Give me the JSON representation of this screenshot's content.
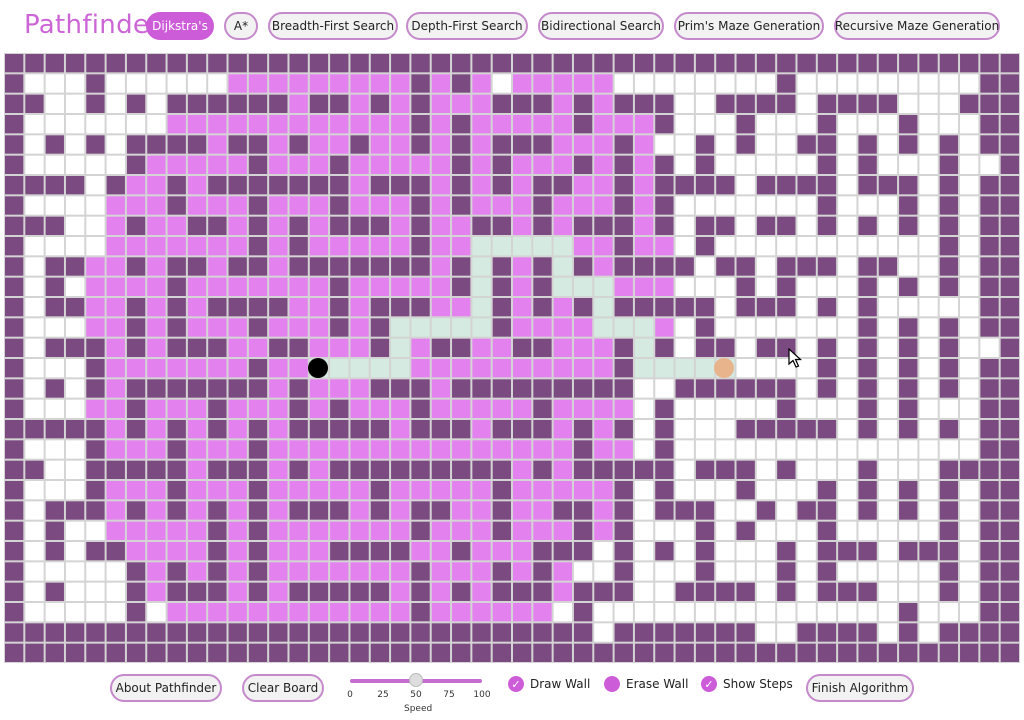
{
  "app": {
    "title": "Pathfinder"
  },
  "algorithms": [
    {
      "label": "Dijkstra's",
      "active": true
    },
    {
      "label": "A*",
      "active": false
    },
    {
      "label": "Breadth-First Search",
      "active": false
    },
    {
      "label": "Depth-First Search",
      "active": false
    },
    {
      "label": "Bidirectional Search",
      "active": false
    },
    {
      "label": "Prim's Maze Generation",
      "active": false
    },
    {
      "label": "Recursive Maze Generation",
      "active": false
    }
  ],
  "footer": {
    "about_label": "About Pathfinder",
    "clear_label": "Clear Board",
    "finish_label": "Finish Algorithm",
    "speed": {
      "label": "Speed",
      "value": 50,
      "ticks": [
        "0",
        "25",
        "50",
        "75",
        "100"
      ]
    },
    "options": [
      {
        "label": "Draw Wall",
        "checked": true
      },
      {
        "label": "Erase Wall",
        "checked": false
      },
      {
        "label": "Show Steps",
        "checked": true
      }
    ]
  },
  "colors": {
    "wall": "#7b4a80",
    "empty": "#ffffff",
    "visited": "#e382ef",
    "path": "#d5eae0",
    "grid_line": "#d4d4d4",
    "start": "#000000",
    "end": "#e8b48c",
    "accent": "#cc5cd8"
  },
  "grid": {
    "cols": 50,
    "rows": 30,
    "start": [
      15,
      15
    ],
    "end": [
      35,
      15
    ]
  }
}
